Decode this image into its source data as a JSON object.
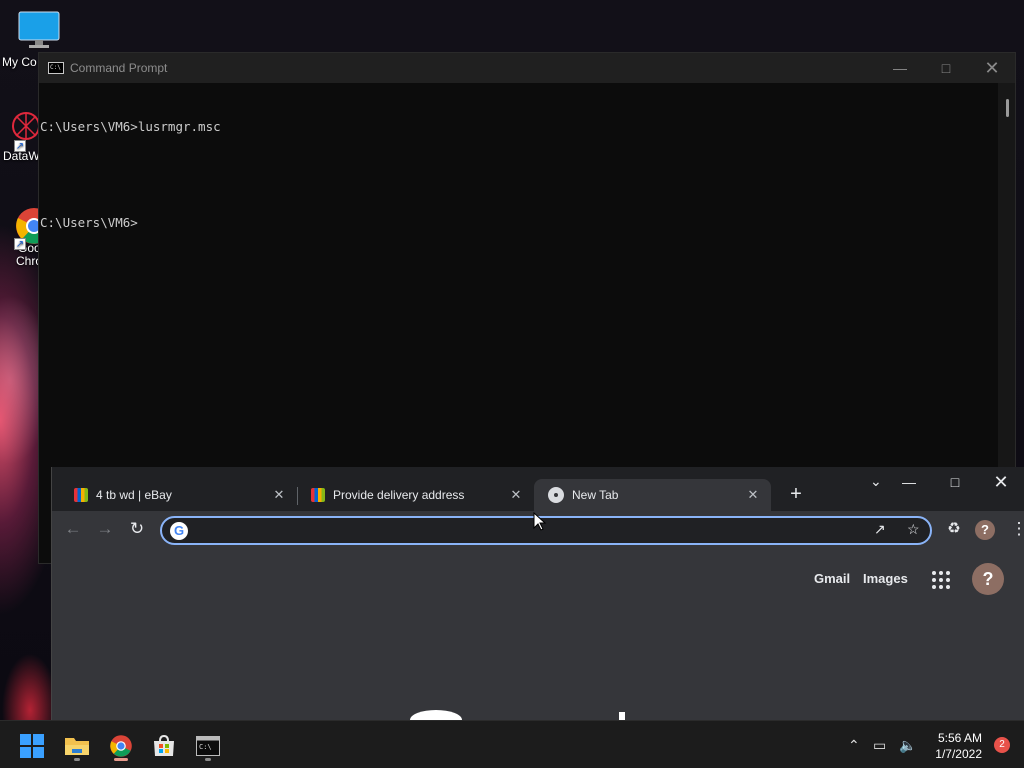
{
  "desktop": {
    "icons": [
      {
        "label": "My Co",
        "icon": "monitor-icon"
      },
      {
        "label": "DataW",
        "icon": "datawrapper-icon"
      },
      {
        "label": "Goo",
        "label2": "Chro",
        "icon": "chrome-icon"
      }
    ]
  },
  "cmd": {
    "title": "Command Prompt",
    "lines": [
      "C:\\Users\\VM6>lusrmgr.msc",
      "",
      "C:\\Users\\VM6>"
    ]
  },
  "chrome": {
    "tabs": [
      {
        "title": "4 tb wd | eBay",
        "favicon": "ebay-icon"
      },
      {
        "title": "Provide delivery address",
        "favicon": "ebay-icon"
      },
      {
        "title": "New Tab",
        "favicon": "chrome-icon",
        "active": true
      }
    ],
    "omnibox": {
      "value": "",
      "placeholder": ""
    },
    "page": {
      "gmail": "Gmail",
      "images": "Images"
    },
    "profile_initial": "?"
  },
  "taskbar": {
    "apps": [
      "start-icon",
      "file-explorer-icon",
      "chrome-icon",
      "microsoft-store-icon",
      "terminal-icon"
    ],
    "time": "5:56 AM",
    "date": "1/7/2022",
    "notifications": "2"
  }
}
